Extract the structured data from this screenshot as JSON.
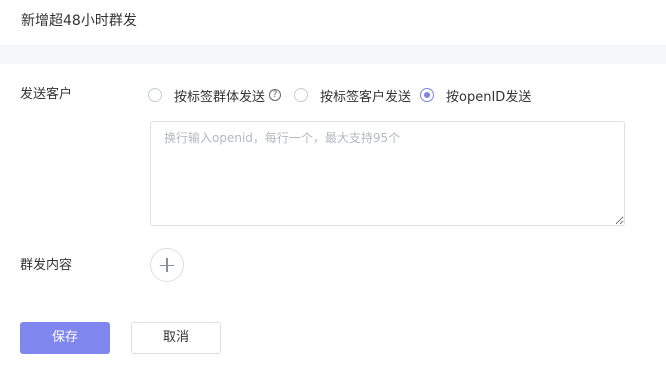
{
  "header": {
    "title": "新增超48小时群发"
  },
  "form": {
    "recipient_label": "发送客户",
    "recipient_options": [
      {
        "label": "按标签群体发送",
        "checked": false,
        "has_help": true
      },
      {
        "label": "按标签客户发送",
        "checked": false,
        "has_help": false
      },
      {
        "label": "按openID发送",
        "checked": true,
        "has_help": false
      }
    ],
    "help_icon_glyph": "?",
    "openid_input": {
      "value": "",
      "placeholder": "换行输入openid，每行一个，最大支持95个"
    },
    "content_label": "群发内容",
    "add_content_icon": "plus-icon"
  },
  "actions": {
    "save_label": "保存",
    "cancel_label": "取消"
  },
  "colors": {
    "accent": "#7f87ee",
    "page_background": "#f5f6fa"
  }
}
